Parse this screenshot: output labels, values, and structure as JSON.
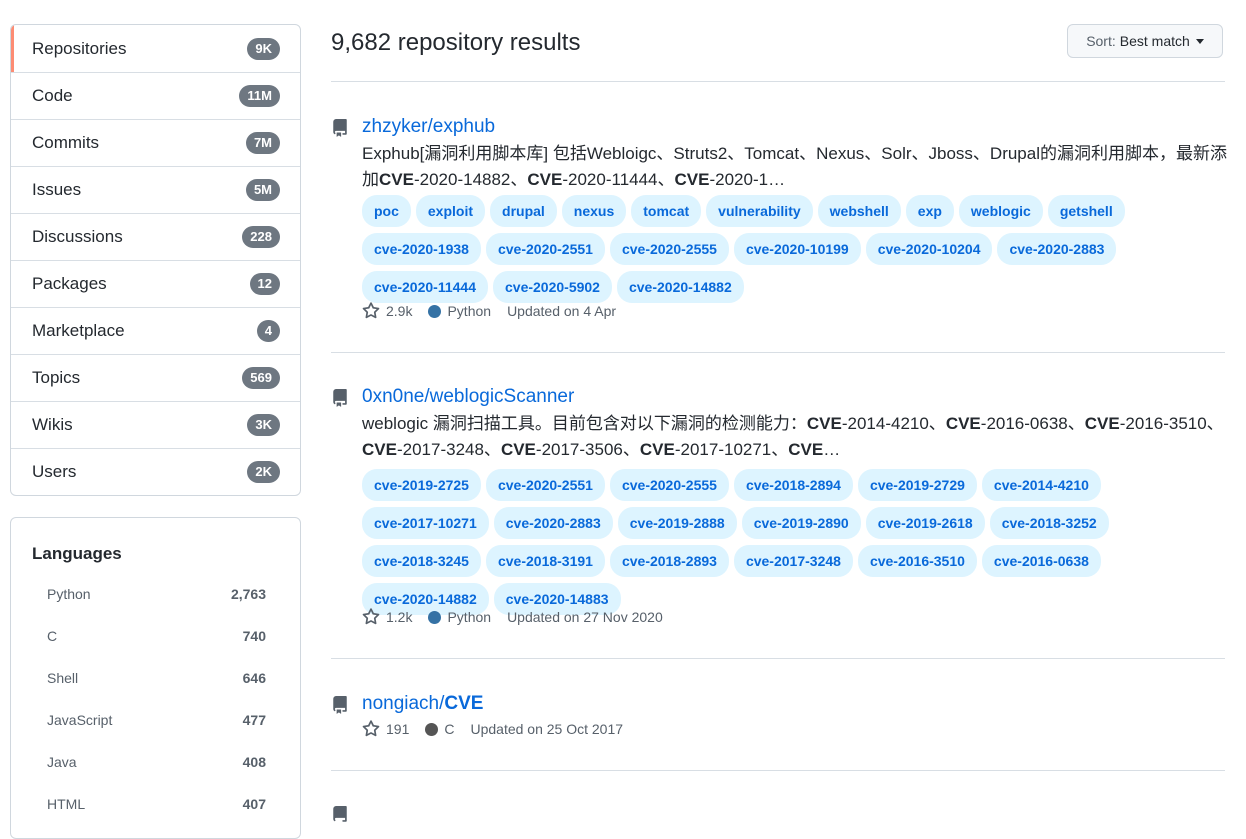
{
  "nav": [
    {
      "label": "Repositories",
      "count": "9K"
    },
    {
      "label": "Code",
      "count": "11M"
    },
    {
      "label": "Commits",
      "count": "7M"
    },
    {
      "label": "Issues",
      "count": "5M"
    },
    {
      "label": "Discussions",
      "count": "228"
    },
    {
      "label": "Packages",
      "count": "12"
    },
    {
      "label": "Marketplace",
      "count": "4"
    },
    {
      "label": "Topics",
      "count": "569"
    },
    {
      "label": "Wikis",
      "count": "3K"
    },
    {
      "label": "Users",
      "count": "2K"
    }
  ],
  "languages": {
    "title": "Languages",
    "items": [
      {
        "name": "Python",
        "count": "2,763"
      },
      {
        "name": "C",
        "count": "740"
      },
      {
        "name": "Shell",
        "count": "646"
      },
      {
        "name": "JavaScript",
        "count": "477"
      },
      {
        "name": "Java",
        "count": "408"
      },
      {
        "name": "HTML",
        "count": "407"
      }
    ]
  },
  "header": {
    "results_title": "9,682 repository results",
    "sort_label": "Sort:",
    "sort_value": "Best match"
  },
  "repos": [
    {
      "owner": "zhzyker/",
      "name": "exphub",
      "desc_parts": [
        "Exphub[漏洞利用脚本库] 包括Webloigc、Struts2、Tomcat、Nexus、Solr、Jboss、Drupal的漏洞利用脚本，最新添加",
        "CVE",
        "-2020-14882、",
        "CVE",
        "-2020-11444、",
        "CVE",
        "-2020-1…"
      ],
      "topics": [
        "poc",
        "exploit",
        "drupal",
        "nexus",
        "tomcat",
        "vulnerability",
        "webshell",
        "exp",
        "weblogic",
        "getshell",
        "cve-2020-1938",
        "cve-2020-2551",
        "cve-2020-2555",
        "cve-2020-10199",
        "cve-2020-10204",
        "cve-2020-2883",
        "cve-2020-11444",
        "cve-2020-5902",
        "cve-2020-14882"
      ],
      "stars": "2.9k",
      "language": "Python",
      "language_color": "#3572A5",
      "updated": "Updated on 4 Apr"
    },
    {
      "owner": "0xn0ne/",
      "name": "weblogicScanner",
      "desc_parts": [
        "weblogic 漏洞扫描工具。目前包含对以下漏洞的检测能力：",
        "CVE",
        "-2014-4210、",
        "CVE",
        "-2016-0638、",
        "CVE",
        "-2016-3510、",
        "CVE",
        "-2017-3248、",
        "CVE",
        "-2017-3506、",
        "CVE",
        "-2017-10271、",
        "CVE",
        "…"
      ],
      "topics": [
        "cve-2019-2725",
        "cve-2020-2551",
        "cve-2020-2555",
        "cve-2018-2894",
        "cve-2019-2729",
        "cve-2014-4210",
        "cve-2017-10271",
        "cve-2020-2883",
        "cve-2019-2888",
        "cve-2019-2890",
        "cve-2019-2618",
        "cve-2018-3252",
        "cve-2018-3245",
        "cve-2018-3191",
        "cve-2018-2893",
        "cve-2017-3248",
        "cve-2016-3510",
        "cve-2016-0638",
        "cve-2020-14882",
        "cve-2020-14883"
      ],
      "stars": "1.2k",
      "language": "Python",
      "language_color": "#3572A5",
      "updated": "Updated on 27 Nov 2020"
    },
    {
      "owner": "nongiach/",
      "name": "CVE",
      "stars": "191",
      "language": "C",
      "language_color": "#555555",
      "updated": "Updated on 25 Oct 2017"
    }
  ]
}
